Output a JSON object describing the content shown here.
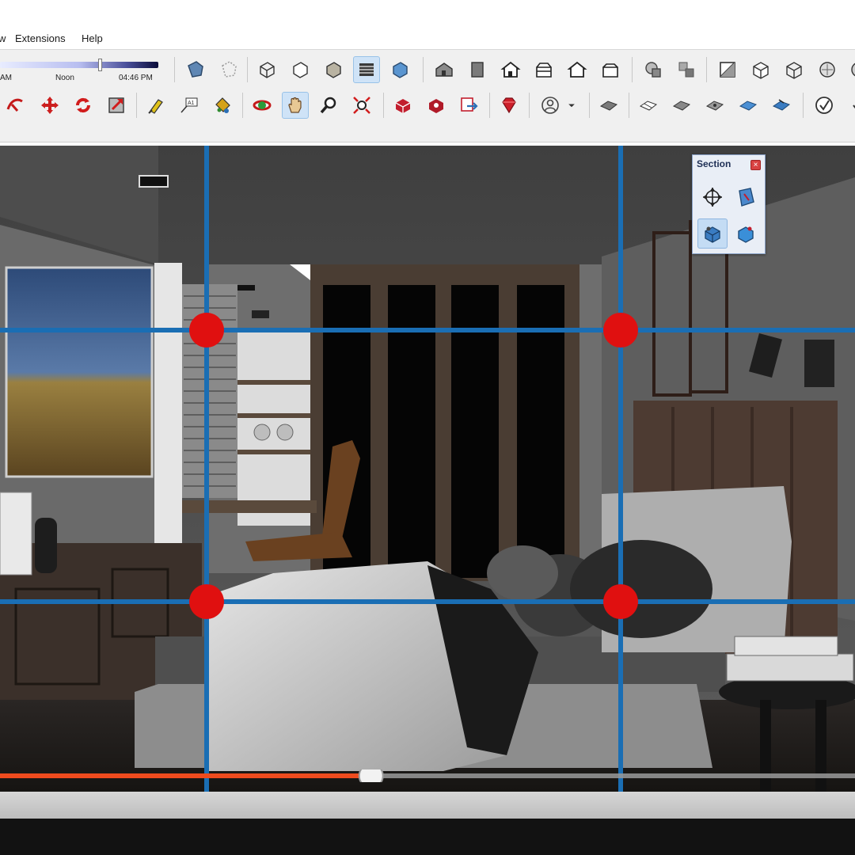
{
  "menu": {
    "items": [
      "w",
      "Extensions",
      "Help"
    ]
  },
  "shadow": {
    "am_label": "AM",
    "noon_label": "Noon",
    "pm_label": "04:46 PM"
  },
  "section_panel": {
    "title": "Section",
    "close_glyph": "×",
    "tools": [
      "section-plane-icon",
      "section-fill-icon",
      "section-cut-icon",
      "section-display-icon"
    ]
  },
  "toolbar_icons": {
    "row1": [
      "xray-icon",
      "back-edges-icon",
      "wireframe-icon",
      "hidden-line-icon",
      "shaded-icon",
      "shaded-textures-icon",
      "monochrome-icon",
      "iso-view-icon",
      "top-view-icon",
      "front-view-icon",
      "right-view-icon",
      "back-view-icon",
      "left-view-icon",
      "intersect-icon",
      "trim-icon",
      "split-icon",
      "outer-shell-icon",
      "union-icon",
      "solid-icon"
    ],
    "row2": [
      "follow-me-icon",
      "move-icon",
      "rotate-icon",
      "scale-icon",
      "tape-measure-icon",
      "text-icon",
      "paint-bucket-icon",
      "orbit-icon",
      "pan-icon",
      "zoom-icon",
      "zoom-extents-icon",
      "3d-warehouse-icon",
      "extension-warehouse-icon",
      "send-to-layout-icon",
      "ruby-icon",
      "account-icon",
      "sandbox-1-icon",
      "sandbox-2-icon",
      "sandbox-3-icon",
      "sandbox-4-icon",
      "sandbox-5-icon",
      "sandbox-6-icon",
      "check-icon"
    ]
  },
  "colors": {
    "guide_line": "#1a6eb4",
    "guide_point": "#e01010",
    "scrubber_fill": "#ee4b1e",
    "accent_active": "#cfe3f7"
  },
  "timeline": {
    "progress": 0.434
  }
}
